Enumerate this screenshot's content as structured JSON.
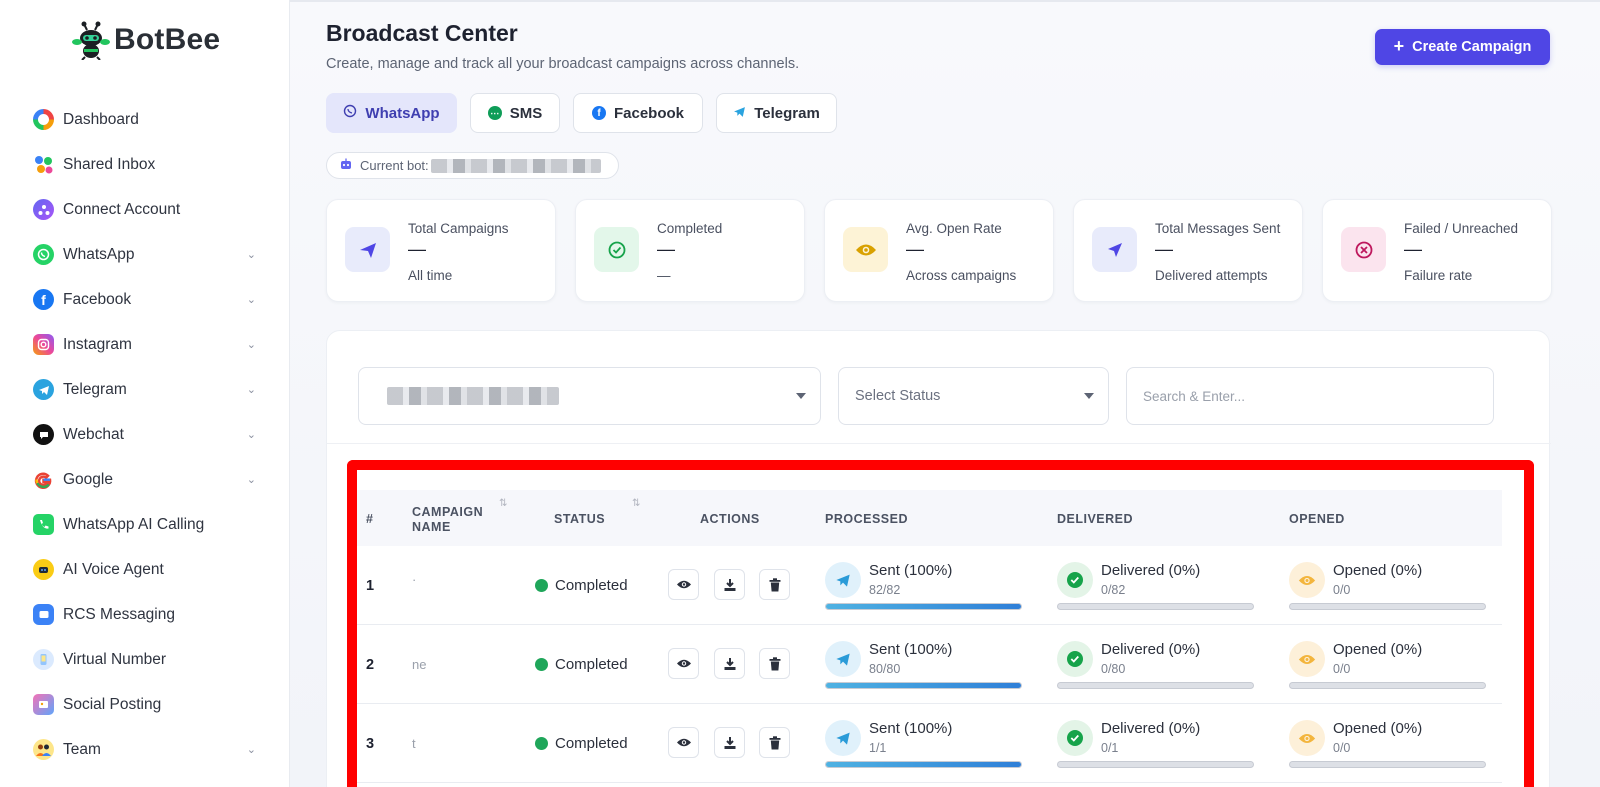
{
  "brand": {
    "name": "BotBee"
  },
  "sidebar": {
    "items": [
      {
        "label": "Dashboard",
        "icon": "dashboard-icon",
        "expandable": false
      },
      {
        "label": "Shared Inbox",
        "icon": "shared-inbox-icon",
        "expandable": false
      },
      {
        "label": "Connect Account",
        "icon": "connect-account-icon",
        "expandable": false
      },
      {
        "label": "WhatsApp",
        "icon": "whatsapp-icon",
        "expandable": true
      },
      {
        "label": "Facebook",
        "icon": "facebook-icon",
        "expandable": true
      },
      {
        "label": "Instagram",
        "icon": "instagram-icon",
        "expandable": true
      },
      {
        "label": "Telegram",
        "icon": "telegram-icon",
        "expandable": true
      },
      {
        "label": "Webchat",
        "icon": "webchat-icon",
        "expandable": true
      },
      {
        "label": "Google",
        "icon": "google-icon",
        "expandable": true
      },
      {
        "label": "WhatsApp AI Calling",
        "icon": "whatsapp-ai-calling-icon",
        "expandable": false
      },
      {
        "label": "AI Voice Agent",
        "icon": "ai-voice-agent-icon",
        "expandable": false
      },
      {
        "label": "RCS Messaging",
        "icon": "rcs-messaging-icon",
        "expandable": false
      },
      {
        "label": "Virtual Number",
        "icon": "virtual-number-icon",
        "expandable": false
      },
      {
        "label": "Social Posting",
        "icon": "social-posting-icon",
        "expandable": false
      },
      {
        "label": "Team",
        "icon": "team-icon",
        "expandable": true
      }
    ]
  },
  "header": {
    "title": "Broadcast Center",
    "subtitle": "Create, manage and track all your broadcast campaigns across channels.",
    "create_button": "Create Campaign"
  },
  "channels": {
    "tabs": [
      {
        "label": "WhatsApp",
        "icon": "whatsapp-icon",
        "active": true
      },
      {
        "label": "SMS",
        "icon": "sms-icon",
        "active": false
      },
      {
        "label": "Facebook",
        "icon": "facebook-icon",
        "active": false
      },
      {
        "label": "Telegram",
        "icon": "telegram-icon",
        "active": false
      }
    ]
  },
  "current_bot": {
    "label": "Current bot:"
  },
  "stats": [
    {
      "title": "Total Campaigns",
      "value": "—",
      "sub": "All time",
      "icon": "send-icon",
      "color": "#e8ebfb"
    },
    {
      "title": "Completed",
      "value": "—",
      "sub": "—",
      "icon": "check-circle-icon",
      "color": "#e3f7ea"
    },
    {
      "title": "Avg. Open Rate",
      "value": "—",
      "sub": "Across campaigns",
      "icon": "eye-icon",
      "color": "#fdf3d6"
    },
    {
      "title": "Total Messages Sent",
      "value": "—",
      "sub": "Delivered attempts",
      "icon": "navigation-arrow-icon",
      "color": "#e8ebfb"
    },
    {
      "title": "Failed / Unreached",
      "value": "—",
      "sub": "Failure rate",
      "icon": "x-circle-icon",
      "color": "#fbe4ee"
    }
  ],
  "filters": {
    "status_placeholder": "Select Status",
    "search_placeholder": "Search & Enter..."
  },
  "table": {
    "columns": [
      "#",
      "CAMPAIGN NAME",
      "STATUS",
      "ACTIONS",
      "PROCESSED",
      "DELIVERED",
      "OPENED"
    ],
    "rows": [
      {
        "num": "1",
        "name": "·",
        "status": "Completed",
        "processed": "Sent (100%)",
        "processed_count": "82/82",
        "processed_pct": 100,
        "delivered": "Delivered (0%)",
        "delivered_count": "0/82",
        "delivered_pct": 0,
        "opened": "Opened (0%)",
        "opened_count": "0/0",
        "opened_pct": 0
      },
      {
        "num": "2",
        "name": "ne",
        "status": "Completed",
        "processed": "Sent (100%)",
        "processed_count": "80/80",
        "processed_pct": 100,
        "delivered": "Delivered (0%)",
        "delivered_count": "0/80",
        "delivered_pct": 0,
        "opened": "Opened (0%)",
        "opened_count": "0/0",
        "opened_pct": 0
      },
      {
        "num": "3",
        "name": "t",
        "status": "Completed",
        "processed": "Sent (100%)",
        "processed_count": "1/1",
        "processed_pct": 100,
        "delivered": "Delivered (0%)",
        "delivered_count": "0/1",
        "delivered_pct": 0,
        "opened": "Opened (0%)",
        "opened_count": "0/0",
        "opened_pct": 0
      }
    ]
  },
  "colors": {
    "accent": "#4f46e5",
    "success": "#1fa65a",
    "highlight_border": "#ff0000"
  }
}
